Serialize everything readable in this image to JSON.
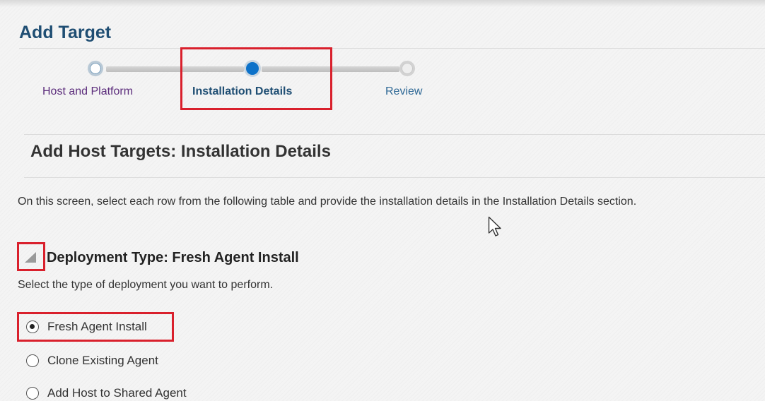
{
  "page": {
    "title": "Add Target"
  },
  "train": {
    "steps": [
      {
        "label": "Host and Platform",
        "state": "visited"
      },
      {
        "label": "Installation Details",
        "state": "current"
      },
      {
        "label": "Review",
        "state": "future"
      }
    ]
  },
  "section": {
    "title": "Add Host Targets: Installation Details",
    "instruction": "On this screen, select each row from the following table and provide the installation details in the Installation Details section."
  },
  "deployment": {
    "header": "Deployment Type: Fresh Agent Install",
    "description": "Select the type of deployment you want to perform.",
    "options": [
      {
        "label": "Fresh Agent Install",
        "selected": true
      },
      {
        "label": "Clone Existing Agent",
        "selected": false
      },
      {
        "label": "Add Host to Shared Agent",
        "selected": false
      }
    ]
  },
  "colors": {
    "title": "#1f4e73",
    "current_step": "#0d72c9",
    "highlight": "#d9202c",
    "visited_label": "#5c2d7c"
  },
  "icons": {
    "disclosure": "triangle-expanded-icon",
    "cursor": "mouse-pointer-icon"
  }
}
